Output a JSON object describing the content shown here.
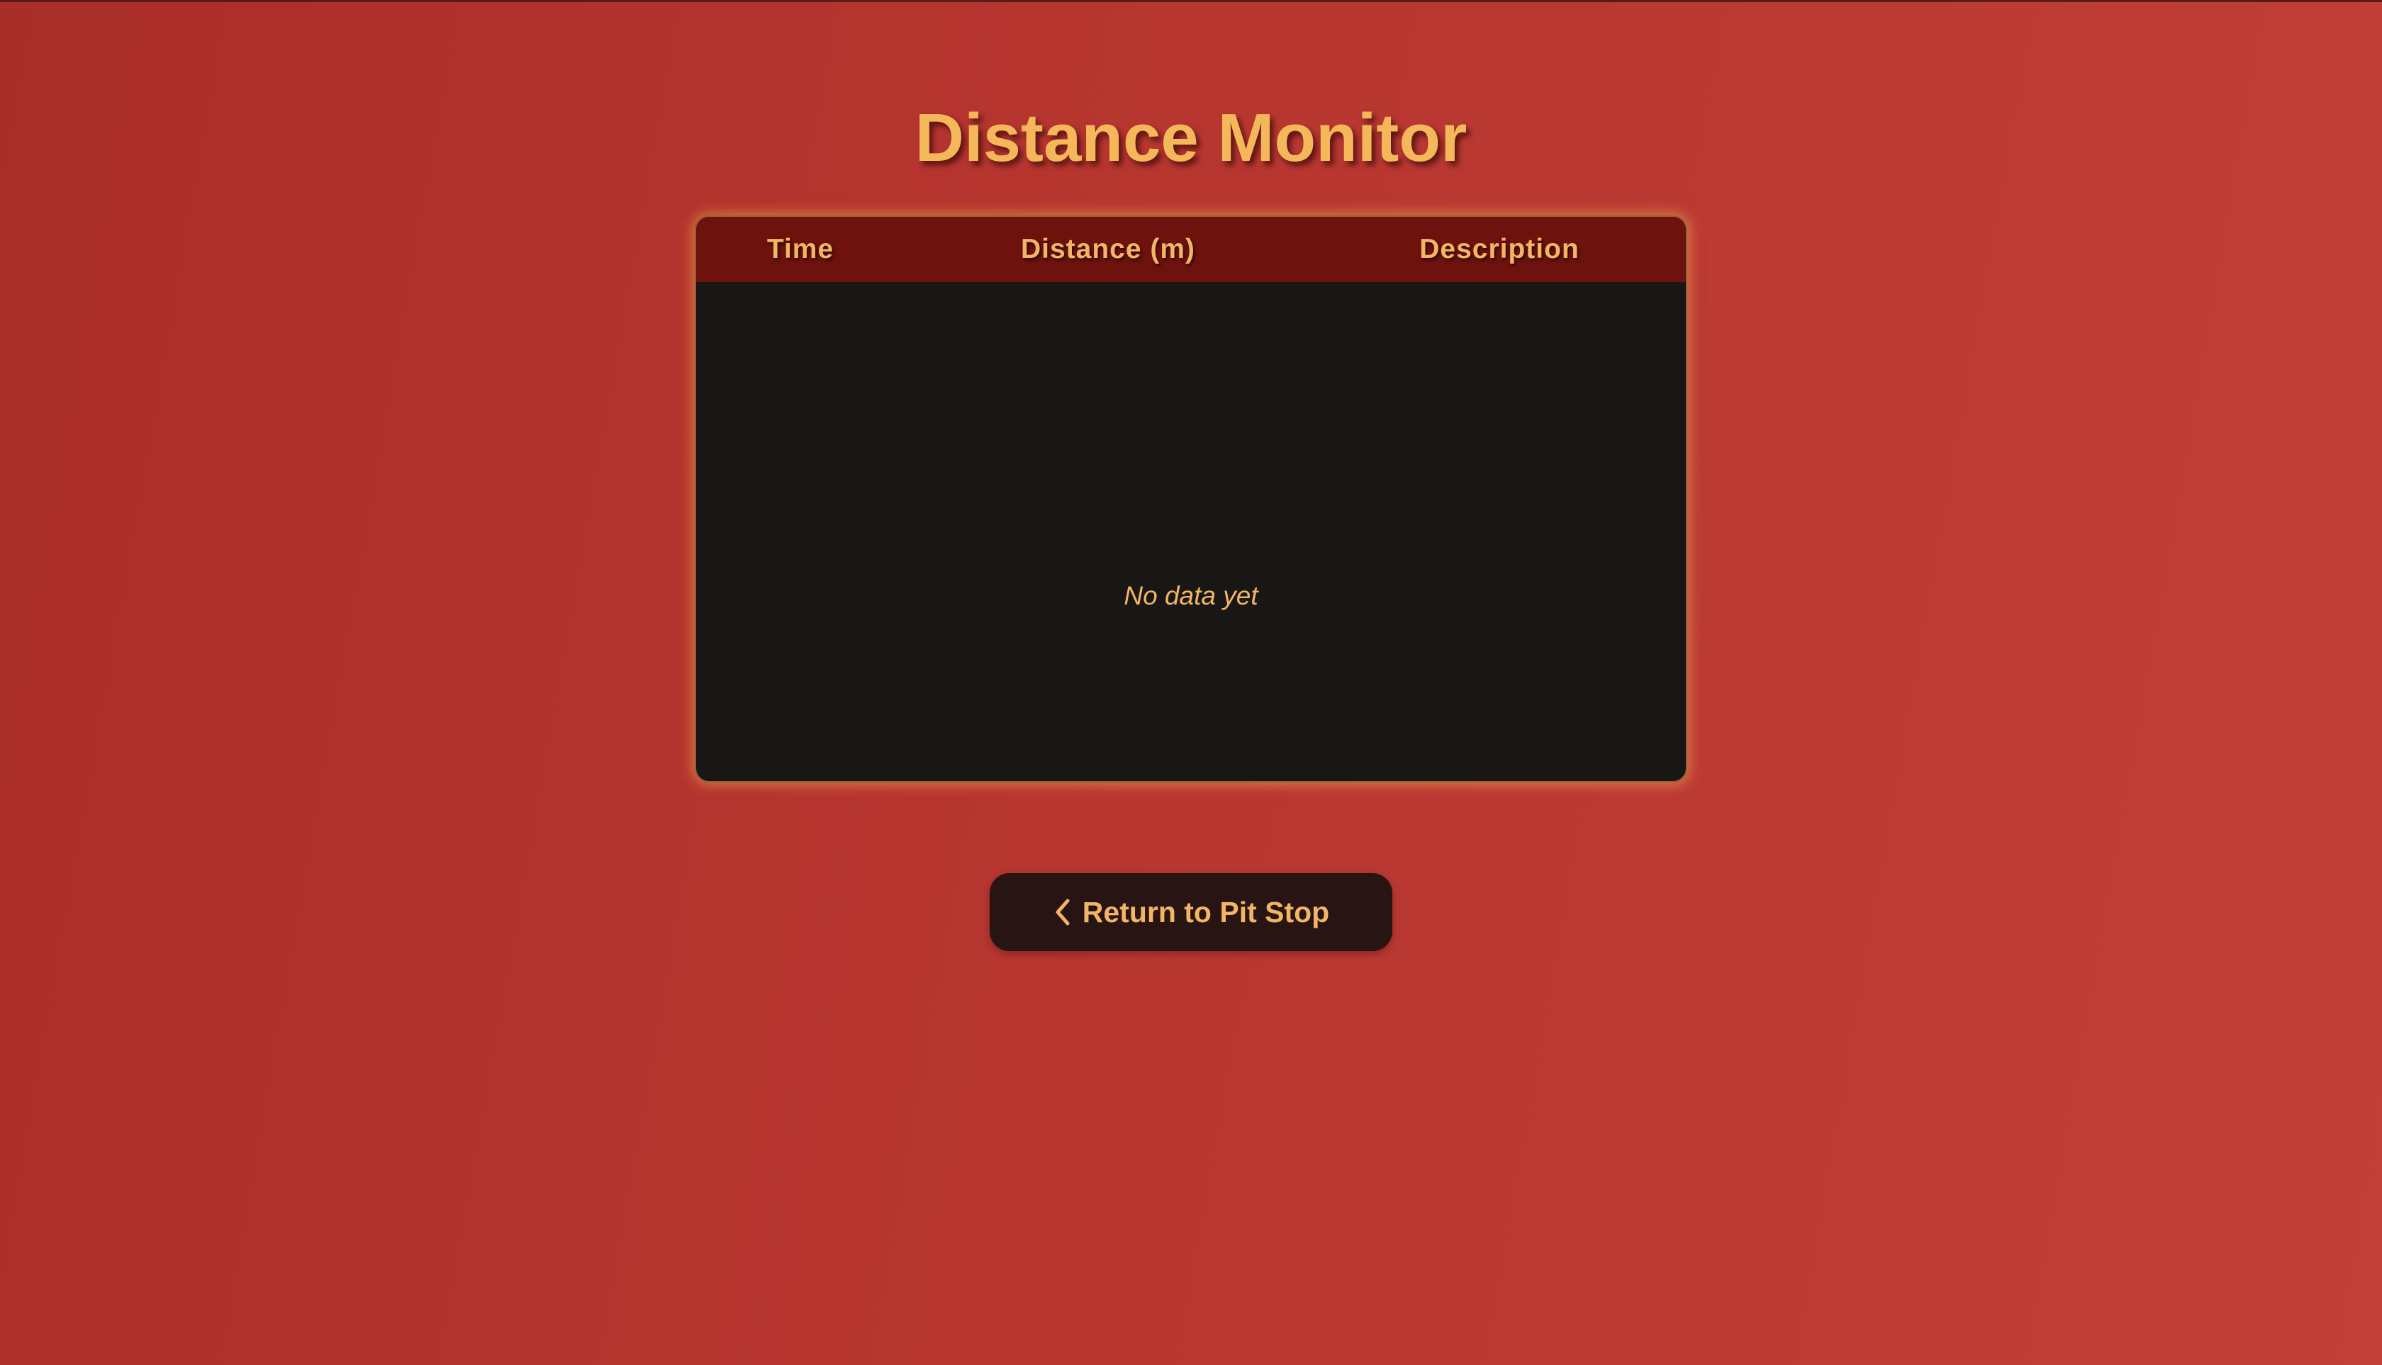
{
  "page": {
    "title": "Distance Monitor"
  },
  "table": {
    "columns": [
      "Time",
      "Distance (m)",
      "Description"
    ],
    "rows": [],
    "empty_message": "No data yet"
  },
  "actions": {
    "back_label": "Return to Pit Stop",
    "back_icon": "chevron-left-icon"
  },
  "colors": {
    "accent": "#f4b85a",
    "header_bg": "#6e120e",
    "panel_bg": "#181715",
    "button_bg": "#271413"
  }
}
